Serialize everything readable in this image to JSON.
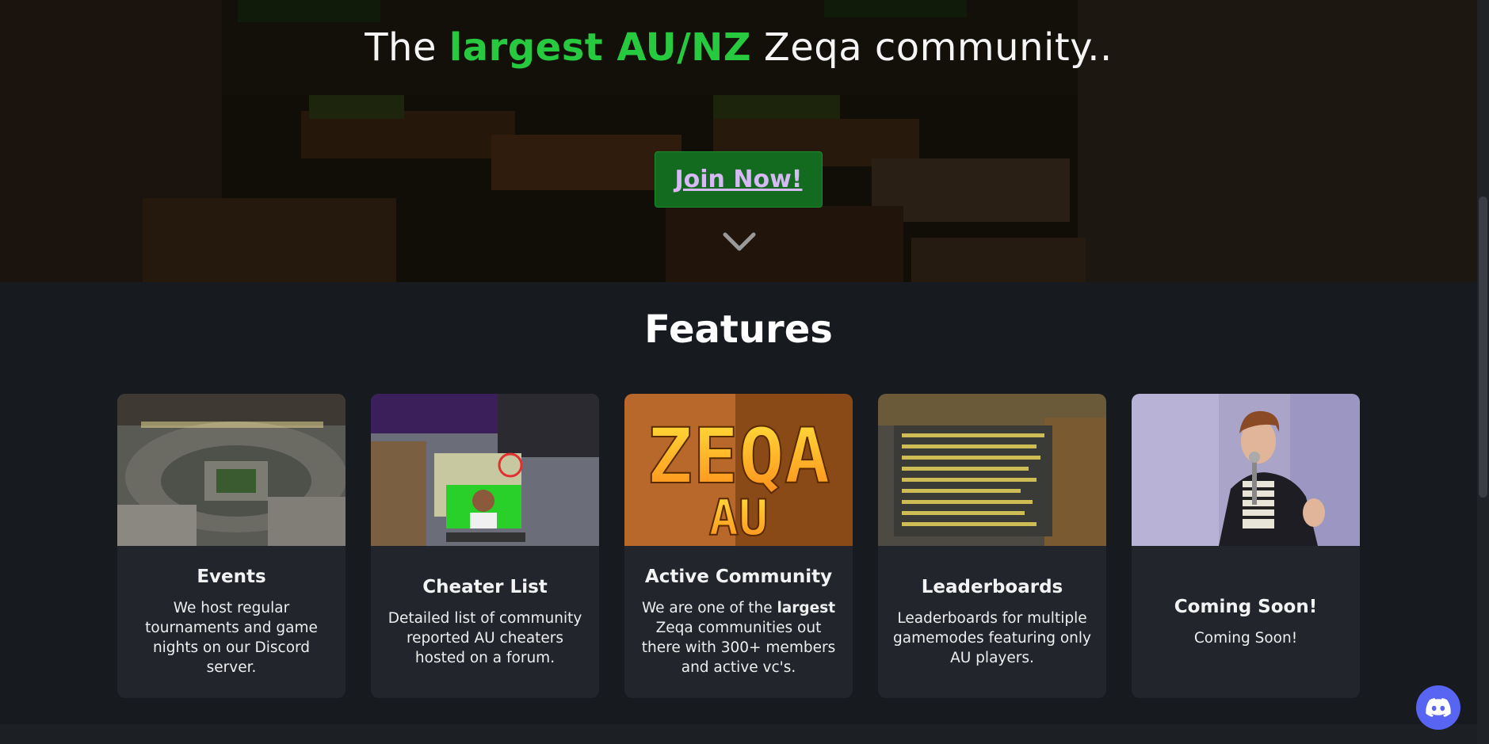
{
  "hero": {
    "headline_pre": "The ",
    "headline_highlight": "largest AU/NZ",
    "headline_post": " Zeqa community..",
    "join_label": "Join Now!",
    "scroll_icon": "chevron-down-icon",
    "accent_color": "#27c93f",
    "button_color": "#136b1f",
    "button_text_color": "#d7b9f5"
  },
  "features": {
    "title": "Features",
    "cards": [
      {
        "title": "Events",
        "desc": "We host regular tournaments and game nights on our Discord server."
      },
      {
        "title": "Cheater List",
        "desc": "Detailed list of community reported AU cheaters hosted on a forum."
      },
      {
        "title": "Active Community",
        "desc_pre": "We are one of the ",
        "desc_bold": "largest",
        "desc_post": " Zeqa communities out there with 300+ members and active vc's."
      },
      {
        "title": "Leaderboards",
        "desc": "Leaderboards for multiple gamemodes featuring only AU players."
      },
      {
        "title": "Coming Soon!",
        "desc": "Coming Soon!"
      }
    ],
    "logo_text": {
      "line1": "ZEQA",
      "line2": "AU"
    }
  },
  "discord": {
    "icon": "discord-icon",
    "color": "#5865f2"
  }
}
